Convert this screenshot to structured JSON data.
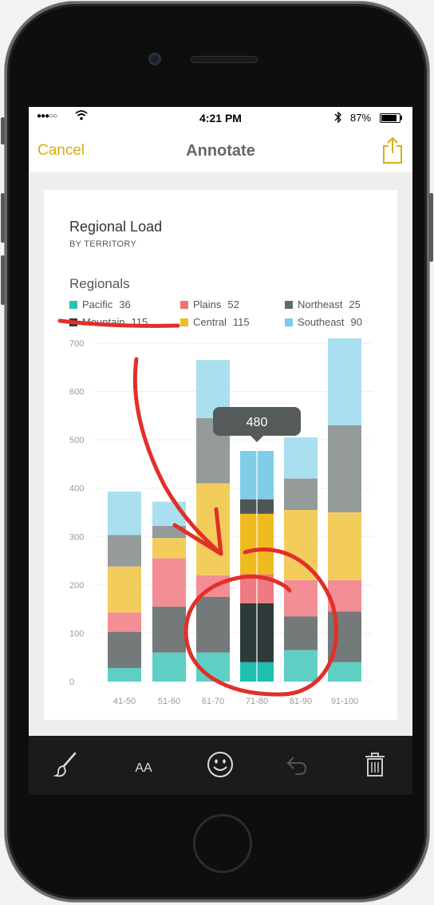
{
  "status": {
    "signal": "●●●○○",
    "time": "4:21 PM",
    "battery": "87%"
  },
  "nav": {
    "cancel": "Cancel",
    "title": "Annotate"
  },
  "card": {
    "title": "Regional Load",
    "subtitle": "BY TERRITORY",
    "legend_title": "Regionals",
    "legend": [
      {
        "name": "Pacific",
        "value": "36",
        "color": "#2bc1b3"
      },
      {
        "name": "Plains",
        "value": "52",
        "color": "#f07178"
      },
      {
        "name": "Northeast",
        "value": "25",
        "color": "#5f6a6a"
      },
      {
        "name": "Mountain",
        "value": "115",
        "color": "#2e3a3a"
      },
      {
        "name": "Central",
        "value": "115",
        "color": "#f0bd2a"
      },
      {
        "name": "Southeast",
        "value": "90",
        "color": "#79cde6"
      }
    ]
  },
  "chart_data": {
    "type": "bar",
    "stacked": true,
    "categories": [
      "41-50",
      "51-60",
      "61-70",
      "71-80",
      "81-90",
      "91-100"
    ],
    "yticks": [
      0,
      100,
      200,
      300,
      400,
      500,
      600,
      700
    ],
    "ylim": [
      0,
      700
    ],
    "highlight": {
      "category": "71-80",
      "label": "480"
    },
    "series": [
      {
        "name": "Pacific",
        "color": "#5fcfc6",
        "values": [
          28,
          60,
          60,
          40,
          65,
          40
        ]
      },
      {
        "name": "Mountain",
        "color": "#74797a",
        "values": [
          75,
          95,
          115,
          122,
          70,
          105
        ]
      },
      {
        "name": "Plains",
        "color": "#f38e95",
        "values": [
          40,
          100,
          45,
          60,
          75,
          65
        ]
      },
      {
        "name": "Central",
        "color": "#f3cd5c",
        "values": [
          95,
          42,
          190,
          125,
          145,
          140
        ]
      },
      {
        "name": "Northeast",
        "color": "#959a9b",
        "values": [
          65,
          25,
          135,
          30,
          65,
          180
        ]
      },
      {
        "name": "Southeast",
        "color": "#a9dfee",
        "values": [
          90,
          50,
          120,
          100,
          85,
          180
        ]
      }
    ],
    "highlight_colors": [
      "#1fbfb0",
      "#2e3a3a",
      "#f07a82",
      "#eebb20",
      "#4e5555",
      "#80cde8"
    ]
  },
  "toolbar": {
    "items": [
      {
        "name": "brush-icon"
      },
      {
        "name": "text-size-icon",
        "label": "AA"
      },
      {
        "name": "smiley-icon"
      },
      {
        "name": "undo-icon"
      },
      {
        "name": "trash-icon"
      }
    ]
  },
  "annotation_color": "#e0302a"
}
